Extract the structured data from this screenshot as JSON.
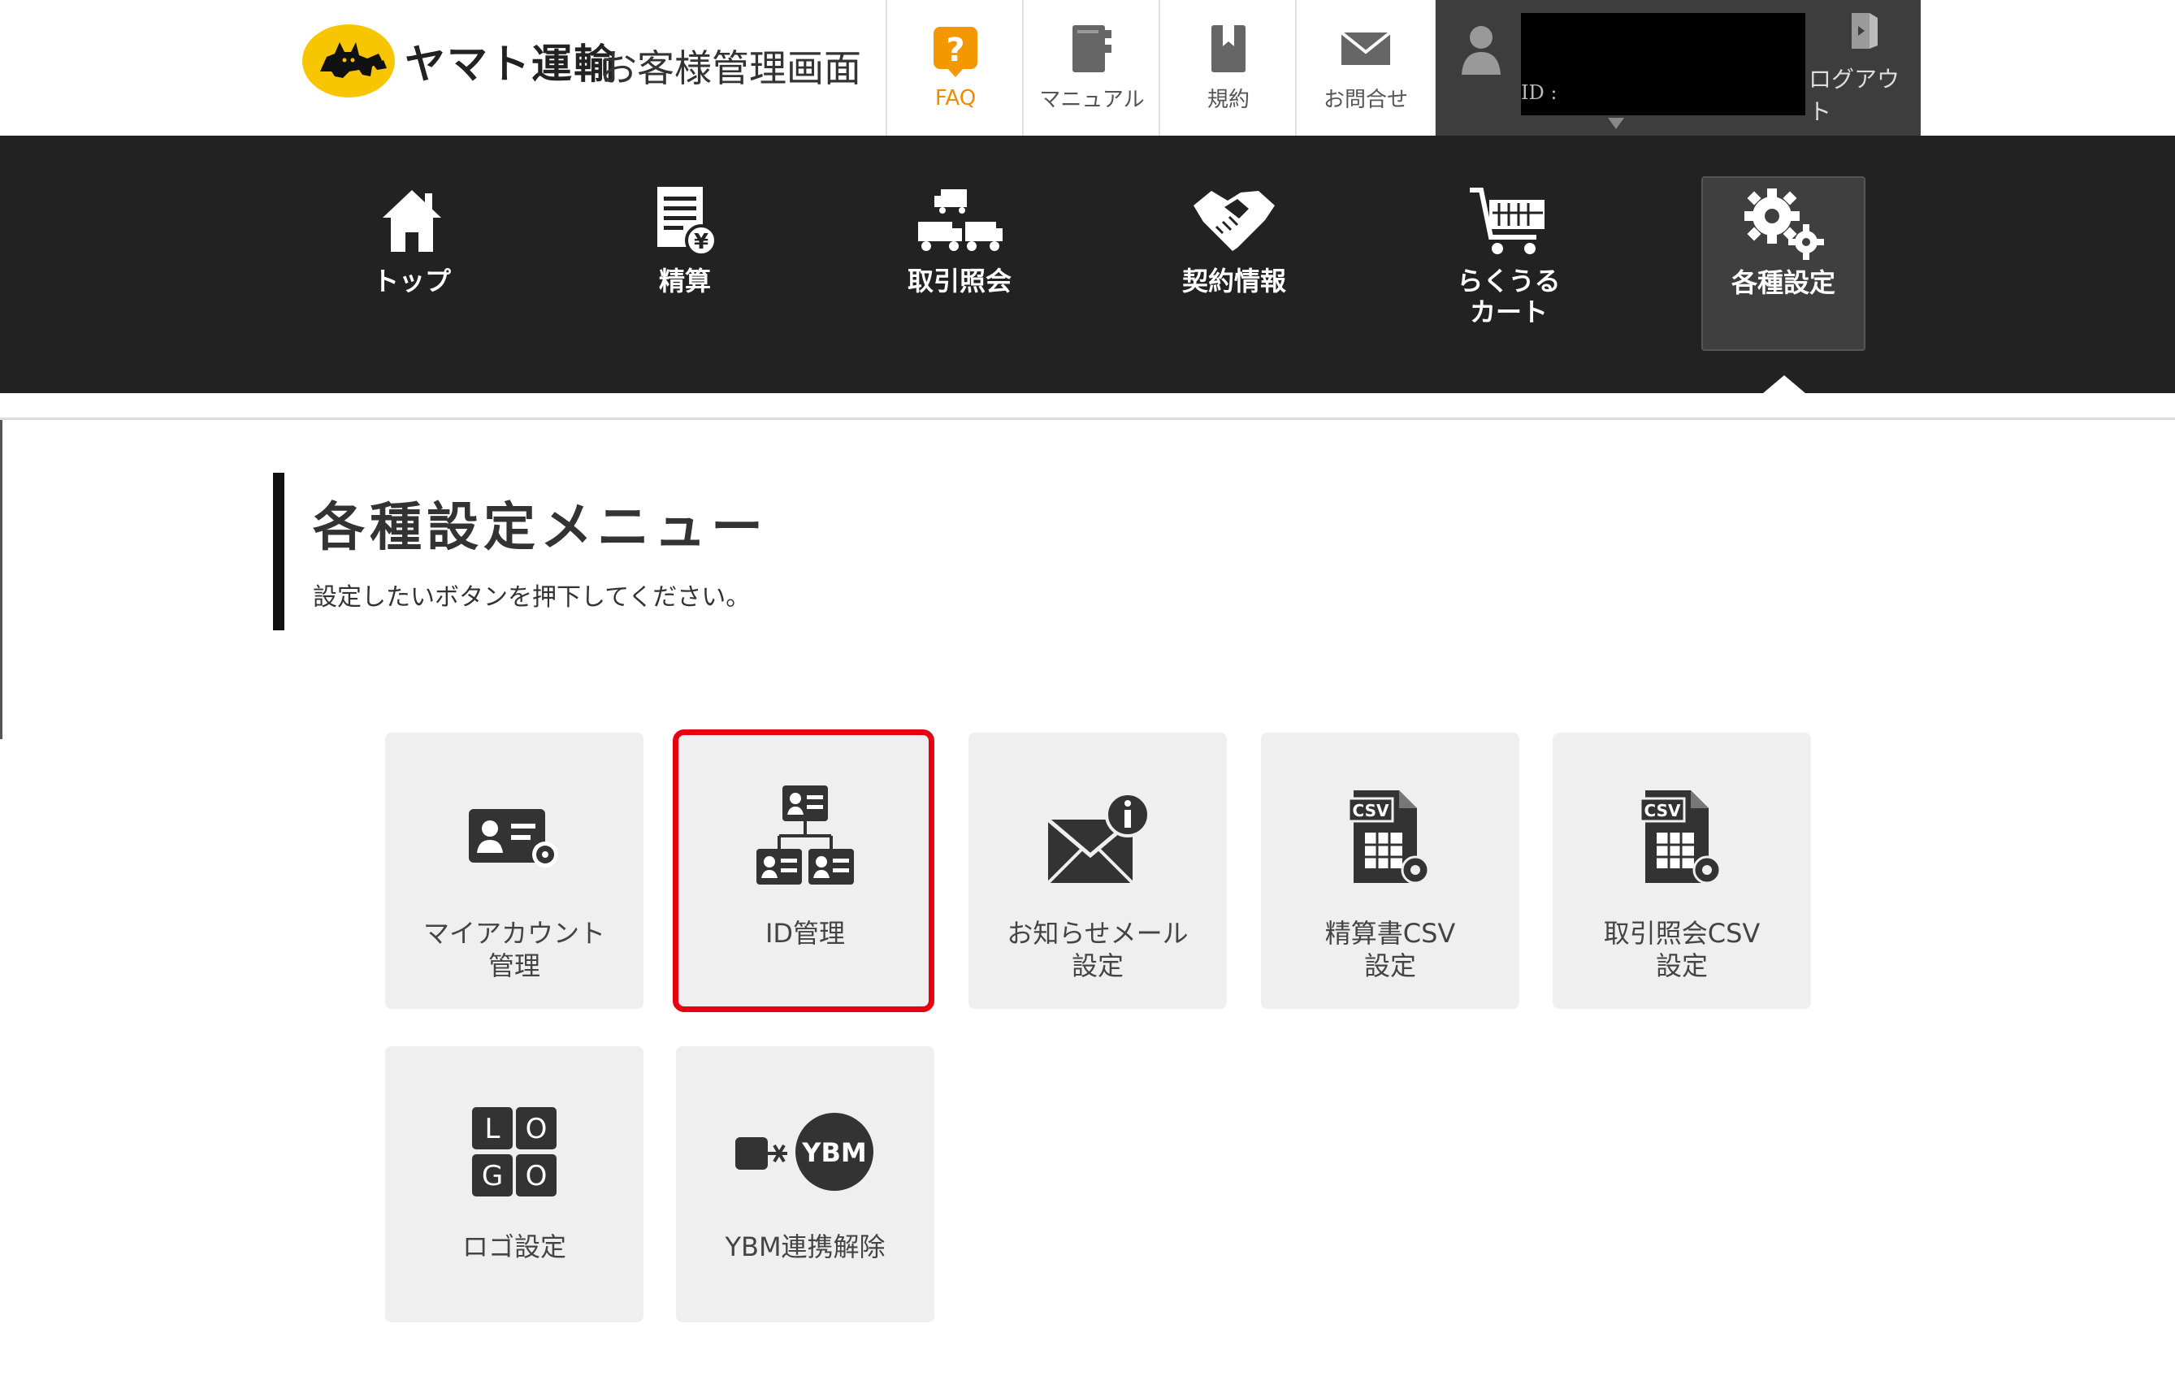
{
  "header": {
    "logo_text": "ヤマト運輸",
    "site_title": "お客様管理画面",
    "utilities": [
      {
        "label": "FAQ",
        "icon": "question-icon"
      },
      {
        "label": "マニュアル",
        "icon": "book-icon"
      },
      {
        "label": "規約",
        "icon": "bookmark-book-icon"
      },
      {
        "label": "お問合せ",
        "icon": "mail-icon"
      }
    ],
    "user": {
      "id_label": "ID :",
      "logout_label": "ログアウト"
    }
  },
  "nav": {
    "items": [
      {
        "label": "トップ",
        "icon": "home-icon"
      },
      {
        "label": "精算",
        "icon": "invoice-yen-icon"
      },
      {
        "label": "取引照会",
        "icon": "trucks-icon"
      },
      {
        "label": "契約情報",
        "icon": "handshake-icon"
      },
      {
        "label": "らくうる\nカート",
        "icon": "cart-icon"
      },
      {
        "label": "各種設定",
        "icon": "gears-icon",
        "active": true
      }
    ]
  },
  "main": {
    "title": "各種設定メニュー",
    "subtitle": "設定したいボタンを押下してください。",
    "tiles": [
      {
        "label": "マイアカウント\n管理",
        "icon": "id-card-gear-icon"
      },
      {
        "label": "ID管理",
        "icon": "id-hierarchy-icon",
        "highlighted": true
      },
      {
        "label": "お知らせメール\n設定",
        "icon": "mail-info-icon"
      },
      {
        "label": "精算書CSV\n設定",
        "icon": "csv-file-gear-icon"
      },
      {
        "label": "取引照会CSV\n設定",
        "icon": "csv-file-gear-icon"
      },
      {
        "label": "ロゴ設定",
        "icon": "logo-blocks-icon",
        "logo_letters": [
          "L",
          "O",
          "G",
          "O"
        ]
      },
      {
        "label": "YBM連携解除",
        "icon": "ybm-unlink-icon",
        "badge": "YBM"
      }
    ]
  },
  "colors": {
    "brand_yellow": "#f7c600",
    "nav_bg": "#222222",
    "faq_orange": "#f08a00",
    "highlight_red": "#e60012",
    "tile_bg": "#efefef"
  }
}
